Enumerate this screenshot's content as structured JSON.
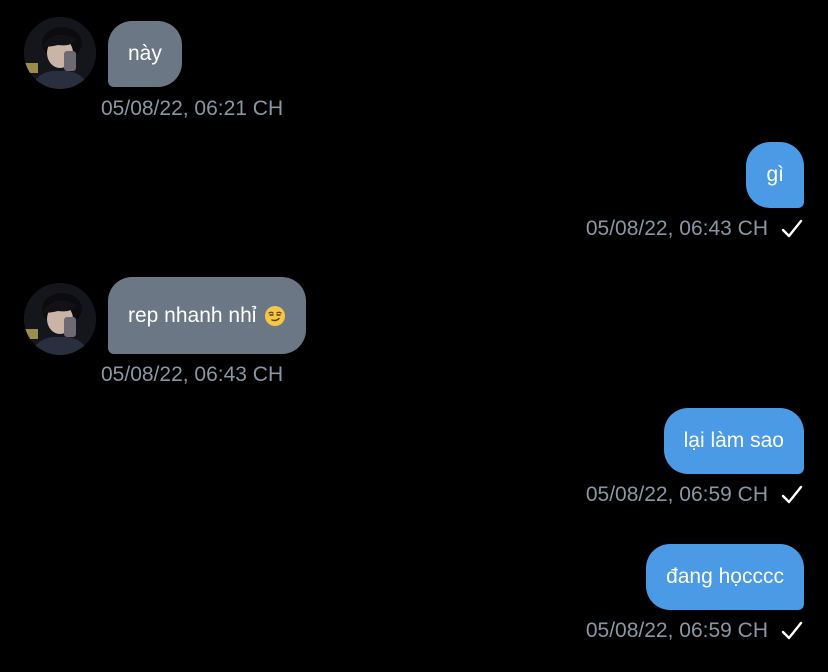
{
  "messages": [
    {
      "direction": "in",
      "text": "này",
      "time": "05/08/22, 06:21 CH"
    },
    {
      "direction": "out",
      "text": "gì",
      "time": "05/08/22, 06:43 CH",
      "status_icon": "checkmark-icon"
    },
    {
      "direction": "in",
      "text": "rep nhanh nhỉ",
      "emoji": "smirking-face-emoji",
      "time": "05/08/22, 06:43 CH"
    },
    {
      "direction": "out",
      "text": "lại làm sao",
      "time": "05/08/22, 06:59 CH",
      "status_icon": "checkmark-icon"
    },
    {
      "direction": "out",
      "text": "đang họcccc",
      "time": "05/08/22, 06:59 CH",
      "status_icon": "checkmark-icon"
    }
  ],
  "colors": {
    "background": "#000000",
    "incoming_bubble": "#6b7784",
    "outgoing_bubble": "#4a9ae6",
    "timestamp": "#8a96a3",
    "text": "#ffffff"
  }
}
